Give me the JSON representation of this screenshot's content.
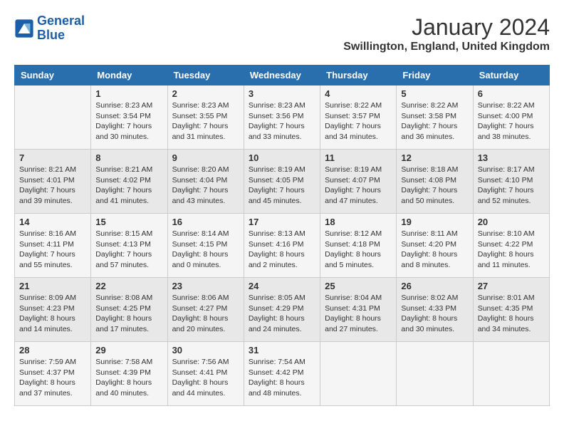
{
  "logo": {
    "text_general": "General",
    "text_blue": "Blue"
  },
  "title": "January 2024",
  "subtitle": "Swillington, England, United Kingdom",
  "days_of_week": [
    "Sunday",
    "Monday",
    "Tuesday",
    "Wednesday",
    "Thursday",
    "Friday",
    "Saturday"
  ],
  "weeks": [
    [
      {
        "day": "",
        "sunrise": "",
        "sunset": "",
        "daylight": ""
      },
      {
        "day": "1",
        "sunrise": "Sunrise: 8:23 AM",
        "sunset": "Sunset: 3:54 PM",
        "daylight": "Daylight: 7 hours and 30 minutes."
      },
      {
        "day": "2",
        "sunrise": "Sunrise: 8:23 AM",
        "sunset": "Sunset: 3:55 PM",
        "daylight": "Daylight: 7 hours and 31 minutes."
      },
      {
        "day": "3",
        "sunrise": "Sunrise: 8:23 AM",
        "sunset": "Sunset: 3:56 PM",
        "daylight": "Daylight: 7 hours and 33 minutes."
      },
      {
        "day": "4",
        "sunrise": "Sunrise: 8:22 AM",
        "sunset": "Sunset: 3:57 PM",
        "daylight": "Daylight: 7 hours and 34 minutes."
      },
      {
        "day": "5",
        "sunrise": "Sunrise: 8:22 AM",
        "sunset": "Sunset: 3:58 PM",
        "daylight": "Daylight: 7 hours and 36 minutes."
      },
      {
        "day": "6",
        "sunrise": "Sunrise: 8:22 AM",
        "sunset": "Sunset: 4:00 PM",
        "daylight": "Daylight: 7 hours and 38 minutes."
      }
    ],
    [
      {
        "day": "7",
        "sunrise": "Sunrise: 8:21 AM",
        "sunset": "Sunset: 4:01 PM",
        "daylight": "Daylight: 7 hours and 39 minutes."
      },
      {
        "day": "8",
        "sunrise": "Sunrise: 8:21 AM",
        "sunset": "Sunset: 4:02 PM",
        "daylight": "Daylight: 7 hours and 41 minutes."
      },
      {
        "day": "9",
        "sunrise": "Sunrise: 8:20 AM",
        "sunset": "Sunset: 4:04 PM",
        "daylight": "Daylight: 7 hours and 43 minutes."
      },
      {
        "day": "10",
        "sunrise": "Sunrise: 8:19 AM",
        "sunset": "Sunset: 4:05 PM",
        "daylight": "Daylight: 7 hours and 45 minutes."
      },
      {
        "day": "11",
        "sunrise": "Sunrise: 8:19 AM",
        "sunset": "Sunset: 4:07 PM",
        "daylight": "Daylight: 7 hours and 47 minutes."
      },
      {
        "day": "12",
        "sunrise": "Sunrise: 8:18 AM",
        "sunset": "Sunset: 4:08 PM",
        "daylight": "Daylight: 7 hours and 50 minutes."
      },
      {
        "day": "13",
        "sunrise": "Sunrise: 8:17 AM",
        "sunset": "Sunset: 4:10 PM",
        "daylight": "Daylight: 7 hours and 52 minutes."
      }
    ],
    [
      {
        "day": "14",
        "sunrise": "Sunrise: 8:16 AM",
        "sunset": "Sunset: 4:11 PM",
        "daylight": "Daylight: 7 hours and 55 minutes."
      },
      {
        "day": "15",
        "sunrise": "Sunrise: 8:15 AM",
        "sunset": "Sunset: 4:13 PM",
        "daylight": "Daylight: 7 hours and 57 minutes."
      },
      {
        "day": "16",
        "sunrise": "Sunrise: 8:14 AM",
        "sunset": "Sunset: 4:15 PM",
        "daylight": "Daylight: 8 hours and 0 minutes."
      },
      {
        "day": "17",
        "sunrise": "Sunrise: 8:13 AM",
        "sunset": "Sunset: 4:16 PM",
        "daylight": "Daylight: 8 hours and 2 minutes."
      },
      {
        "day": "18",
        "sunrise": "Sunrise: 8:12 AM",
        "sunset": "Sunset: 4:18 PM",
        "daylight": "Daylight: 8 hours and 5 minutes."
      },
      {
        "day": "19",
        "sunrise": "Sunrise: 8:11 AM",
        "sunset": "Sunset: 4:20 PM",
        "daylight": "Daylight: 8 hours and 8 minutes."
      },
      {
        "day": "20",
        "sunrise": "Sunrise: 8:10 AM",
        "sunset": "Sunset: 4:22 PM",
        "daylight": "Daylight: 8 hours and 11 minutes."
      }
    ],
    [
      {
        "day": "21",
        "sunrise": "Sunrise: 8:09 AM",
        "sunset": "Sunset: 4:23 PM",
        "daylight": "Daylight: 8 hours and 14 minutes."
      },
      {
        "day": "22",
        "sunrise": "Sunrise: 8:08 AM",
        "sunset": "Sunset: 4:25 PM",
        "daylight": "Daylight: 8 hours and 17 minutes."
      },
      {
        "day": "23",
        "sunrise": "Sunrise: 8:06 AM",
        "sunset": "Sunset: 4:27 PM",
        "daylight": "Daylight: 8 hours and 20 minutes."
      },
      {
        "day": "24",
        "sunrise": "Sunrise: 8:05 AM",
        "sunset": "Sunset: 4:29 PM",
        "daylight": "Daylight: 8 hours and 24 minutes."
      },
      {
        "day": "25",
        "sunrise": "Sunrise: 8:04 AM",
        "sunset": "Sunset: 4:31 PM",
        "daylight": "Daylight: 8 hours and 27 minutes."
      },
      {
        "day": "26",
        "sunrise": "Sunrise: 8:02 AM",
        "sunset": "Sunset: 4:33 PM",
        "daylight": "Daylight: 8 hours and 30 minutes."
      },
      {
        "day": "27",
        "sunrise": "Sunrise: 8:01 AM",
        "sunset": "Sunset: 4:35 PM",
        "daylight": "Daylight: 8 hours and 34 minutes."
      }
    ],
    [
      {
        "day": "28",
        "sunrise": "Sunrise: 7:59 AM",
        "sunset": "Sunset: 4:37 PM",
        "daylight": "Daylight: 8 hours and 37 minutes."
      },
      {
        "day": "29",
        "sunrise": "Sunrise: 7:58 AM",
        "sunset": "Sunset: 4:39 PM",
        "daylight": "Daylight: 8 hours and 40 minutes."
      },
      {
        "day": "30",
        "sunrise": "Sunrise: 7:56 AM",
        "sunset": "Sunset: 4:41 PM",
        "daylight": "Daylight: 8 hours and 44 minutes."
      },
      {
        "day": "31",
        "sunrise": "Sunrise: 7:54 AM",
        "sunset": "Sunset: 4:42 PM",
        "daylight": "Daylight: 8 hours and 48 minutes."
      },
      {
        "day": "",
        "sunrise": "",
        "sunset": "",
        "daylight": ""
      },
      {
        "day": "",
        "sunrise": "",
        "sunset": "",
        "daylight": ""
      },
      {
        "day": "",
        "sunrise": "",
        "sunset": "",
        "daylight": ""
      }
    ]
  ]
}
